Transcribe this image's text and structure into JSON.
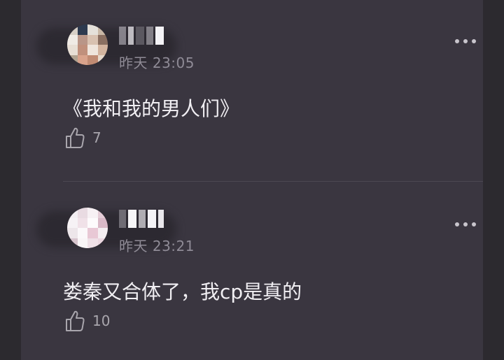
{
  "comments": [
    {
      "time": "昨天 23:05",
      "text": "《我和我的男人们》",
      "likes": "7",
      "avatar_colors": [
        "#d7cfc6",
        "#2d3a4f",
        "#e5e1da",
        "#c9b8a6",
        "#f0ebe5",
        "#b99688",
        "#d8c1b0",
        "#8a6f61",
        "#e8dfd5",
        "#c0907c",
        "#efe5dc",
        "#d3b49f",
        "#b0a290",
        "#d9a38c",
        "#c08b73",
        "#e6d8cb"
      ]
    },
    {
      "time": "昨天 23:21",
      "text": "娄秦又合体了，我cp是真的",
      "likes": "10",
      "avatar_colors": [
        "#f3eef2",
        "#e9dbe2",
        "#f7f1f4",
        "#e4ccd6",
        "#f6f2f5",
        "#f0e1e8",
        "#fdfbfc",
        "#d9b9c7",
        "#ede6ea",
        "#fbf8fa",
        "#e8c8d5",
        "#f4eef1",
        "#d7c4cd",
        "#f9f5f7",
        "#efe0e7",
        "#ebd7e0"
      ]
    }
  ],
  "icons": {
    "more": "more-horizontal-icon",
    "like": "thumbs-up-icon"
  },
  "colors": {
    "panel_bg": "#3a3640",
    "text": "#f1eff3",
    "muted": "#8f8b96"
  }
}
